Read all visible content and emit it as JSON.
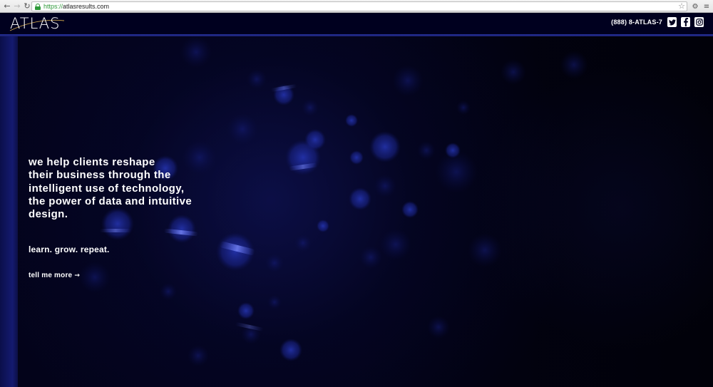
{
  "browser": {
    "url_scheme": "https://",
    "url_host": "atlasresults.com",
    "back_icon": "back-arrow-icon",
    "forward_icon": "forward-arrow-icon",
    "reload_icon": "reload-icon"
  },
  "header": {
    "logo_text": "ATLAS",
    "phone": "(888) 8-ATLAS-7",
    "social": [
      {
        "name": "twitter-icon"
      },
      {
        "name": "facebook-icon"
      },
      {
        "name": "instagram-icon"
      }
    ],
    "bar_color": "#00001f",
    "accent_line_color": "#26309a"
  },
  "hero": {
    "tagline_lines": [
      "we help clients reshape",
      "their business through the",
      "intelligent use of technology,",
      "the power of data and intuitive",
      "design."
    ],
    "motto": "learn. grow. repeat.",
    "cta": "tell me more",
    "cta_icon": "arrow-right-icon",
    "background_color": "#020214"
  }
}
